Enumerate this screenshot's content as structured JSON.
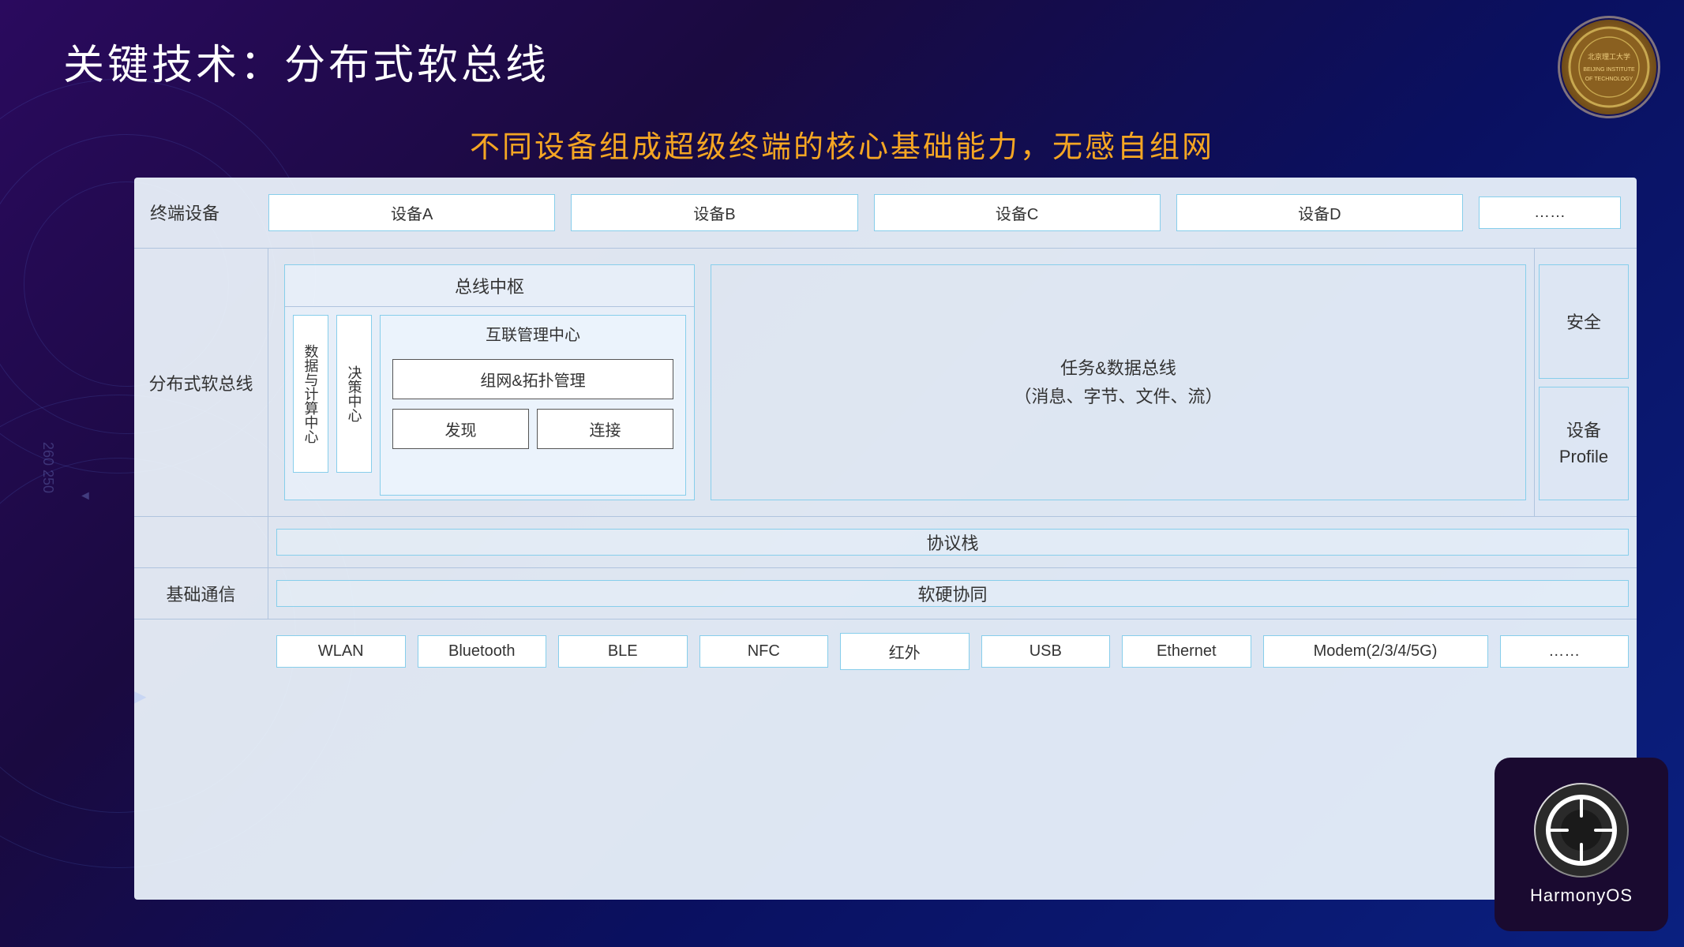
{
  "page": {
    "title": "关键技术：分布式软总线",
    "subtitle": "不同设备组成超级终端的核心基础能力，无感自组网"
  },
  "left_labels": {
    "terminal": "终端设备",
    "distributed": "分布式软总线",
    "basic_comm": "基础通信"
  },
  "devices": {
    "label": "终端设备",
    "items": [
      "设备A",
      "设备B",
      "设备C",
      "设备D",
      "……"
    ]
  },
  "bus_hub": {
    "title": "总线中枢",
    "left_boxes": [
      "数据与计算中心",
      "决策中心"
    ],
    "interconnect": {
      "title": "互联管理中心",
      "network_mgmt": "组网&拓扑管理",
      "discover": "发现",
      "connect": "连接"
    }
  },
  "task_data_bus": {
    "title": "任务&数据总线",
    "subtitle": "（消息、字节、文件、流）"
  },
  "right_col": {
    "security": "安全",
    "profile": "设备\nProfile"
  },
  "protocol_stack": {
    "label": "",
    "title": "协议栈"
  },
  "hw_coordination": {
    "label": "基础通信",
    "title": "软硬协同"
  },
  "tech_items": [
    "WLAN",
    "Bluetooth",
    "BLE",
    "NFC",
    "红外",
    "USB",
    "Ethernet",
    "Modem(2/3/4/5G)",
    "……"
  ],
  "harmony_os": {
    "brand": "HarmonyOS"
  }
}
